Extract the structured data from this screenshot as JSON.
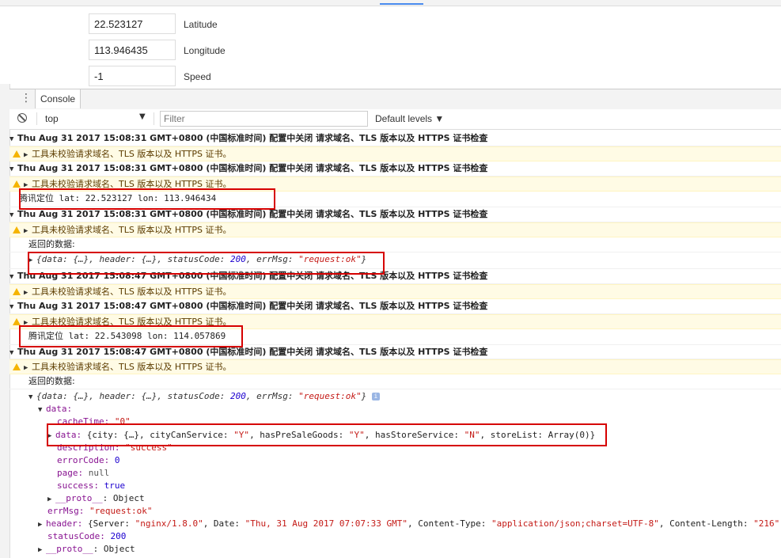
{
  "sensors": {
    "latitude_value": "22.523127",
    "latitude_label": "Latitude",
    "longitude_value": "113.946435",
    "longitude_label": "Longitude",
    "speed_value": "-1",
    "speed_label": "Speed"
  },
  "drawer": {
    "tab_label": "Console"
  },
  "toolbar": {
    "context": "top",
    "filter_placeholder": "Filter",
    "levels_label": "Default levels"
  },
  "log": {
    "group_1": "Thu Aug 31 2017 15:08:31 GMT+0800 (中国标准时间) 配置中关闭 请求域名、TLS 版本以及 HTTPS 证书检查",
    "warn_text": "工具未校验请求域名、TLS 版本以及 HTTPS 证书。",
    "group_2": "Thu Aug 31 2017 15:08:31 GMT+0800 (中国标准时间) 配置中关闭 请求域名、TLS 版本以及 HTTPS 证书检查",
    "loc_1_prefix": "腾讯定位",
    "loc_1_coords": " lat: 22.523127 lon: 113.946434",
    "group_3": "Thu Aug 31 2017 15:08:31 GMT+0800 (中国标准时间) 配置中关闭 请求域名、TLS 版本以及 HTTPS 证书检查",
    "returned_label": "返回的数据:",
    "resp_1": {
      "p1": "{data: {…}, header: {…}, statusCode: ",
      "status": "200",
      "p2": ", errMsg: ",
      "msg": "\"request:ok\"",
      "p3": "}"
    },
    "group_4": "Thu Aug 31 2017 15:08:47 GMT+0800 (中国标准时间) 配置中关闭 请求域名、TLS 版本以及 HTTPS 证书检查",
    "group_5": "Thu Aug 31 2017 15:08:47 GMT+0800 (中国标准时间) 配置中关闭 请求域名、TLS 版本以及 HTTPS 证书检查",
    "loc_2_prefix": "腾讯定位",
    "loc_2_coords": " lat: 22.543098 lon: 114.057869",
    "group_6": "Thu Aug 31 2017 15:08:47 GMT+0800 (中国标准时间) 配置中关闭 请求域名、TLS 版本以及 HTTPS 证书检查",
    "returned_label_2": "返回的数据:",
    "tree": {
      "root_p1": "{data: {…}, header: {…}, statusCode: ",
      "root_status": "200",
      "root_p2": ", errMsg: ",
      "root_msg": "\"request:ok\"",
      "root_p3": "}",
      "data_key": "data:",
      "cacheTime_key": "cacheTime:",
      "cacheTime_val": "\"0\"",
      "inner_data_key": "data:",
      "inner_data_p1": " {city: {…}, cityCanService: ",
      "inner_y1": "\"Y\"",
      "inner_data_p2": ", hasPreSaleGoods: ",
      "inner_y2": "\"Y\"",
      "inner_data_p3": ", hasStoreService: ",
      "inner_n": "\"N\"",
      "inner_data_p4": ", storeList: Array(0)}",
      "description_key": "description:",
      "description_val": "\"success\"",
      "errorCode_key": "errorCode:",
      "errorCode_val": "0",
      "page_key": "page:",
      "page_val": "null",
      "success_key": "success:",
      "success_val": "true",
      "proto_key": "__proto__",
      "proto_val": ": Object",
      "errMsg_key": "errMsg:",
      "errMsg_val": "\"request:ok\"",
      "header_key": "header:",
      "header_p1": " {Server: ",
      "header_server": "\"nginx/1.8.0\"",
      "header_p2": ", Date: ",
      "header_date": "\"Thu, 31 Aug 2017 07:07:33 GMT\"",
      "header_p3": ", Content-Type: ",
      "header_ctype": "\"application/json;charset=UTF-8\"",
      "header_p4": ", Content-Length: ",
      "header_clen": "\"216\",",
      "statusCode_key": "statusCode:",
      "statusCode_val": "200",
      "proto2_key": "__proto__",
      "proto2_val": ": Object"
    }
  },
  "colors": {
    "warning_bg": "#fffbe5",
    "highlight_box": "#d60000",
    "string": "#c41a16",
    "number": "#1c00cf",
    "key": "#881391"
  }
}
